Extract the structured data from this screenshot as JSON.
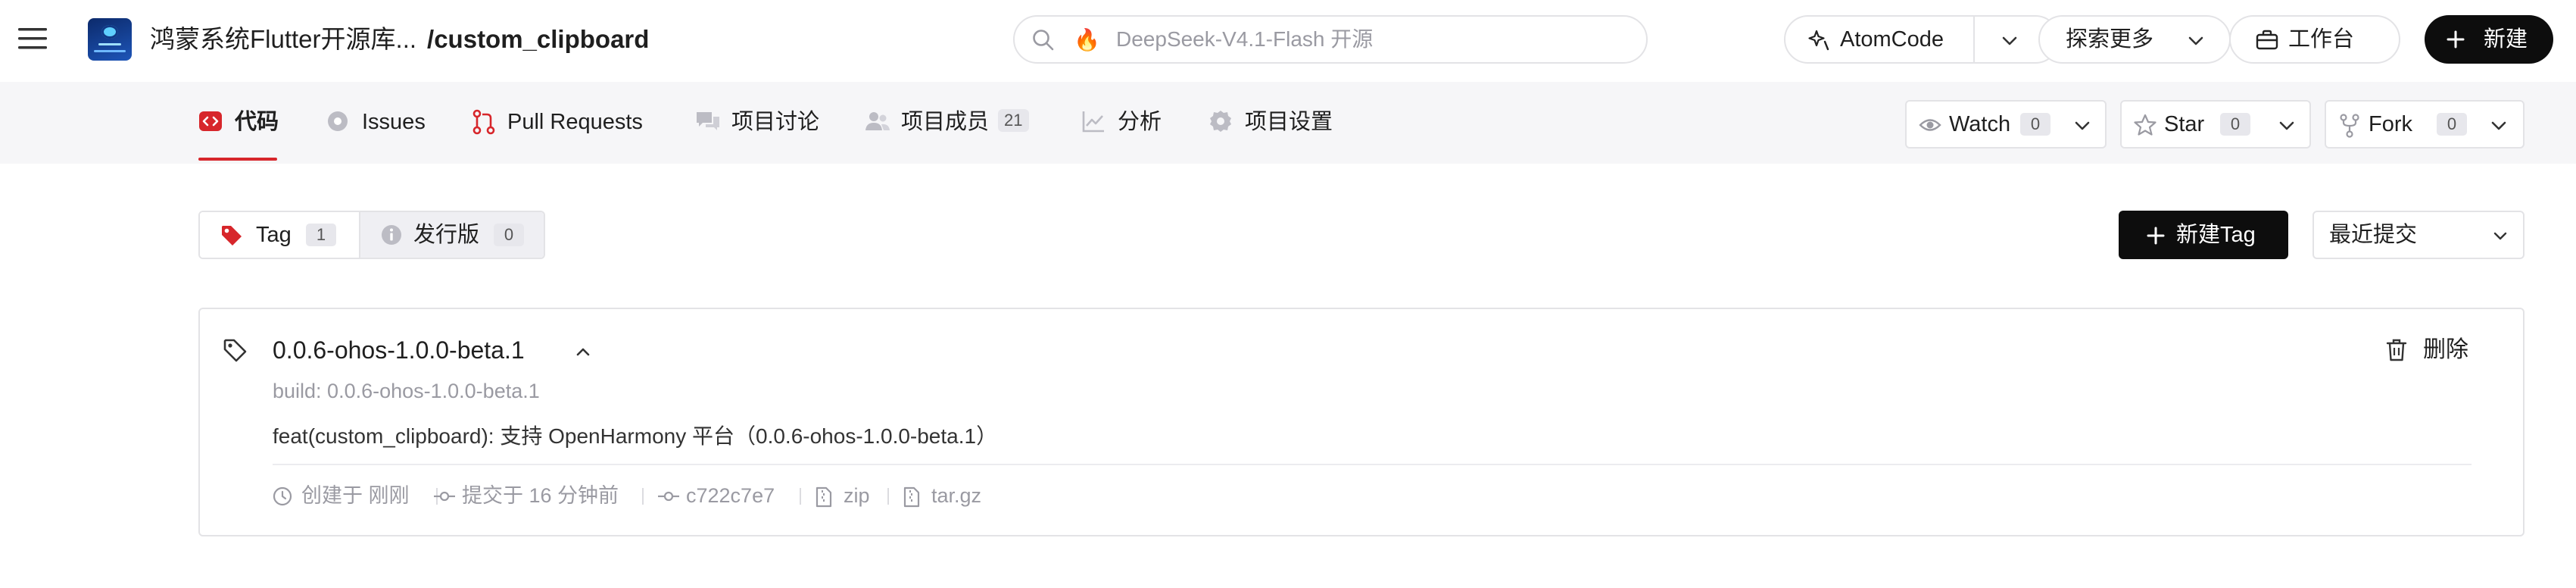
{
  "header": {
    "org_name": "鸿蒙系统Flutter开源库...",
    "repo_name": "/custom_clipboard",
    "search_placeholder": "DeepSeek-V4.1-Flash 开源",
    "atomcode_label": "AtomCode",
    "explore_label": "探索更多",
    "workbench_label": "工作台",
    "new_label": "新建"
  },
  "nav": {
    "tabs": [
      {
        "label": "代码",
        "icon": "code-icon",
        "active": true
      },
      {
        "label": "Issues",
        "icon": "issues-icon"
      },
      {
        "label": "Pull Requests",
        "icon": "pull-request-icon"
      },
      {
        "label": "项目讨论",
        "icon": "discussion-icon"
      },
      {
        "label": "项目成员",
        "icon": "members-icon",
        "count": "21"
      },
      {
        "label": "分析",
        "icon": "analytics-icon"
      },
      {
        "label": "项目设置",
        "icon": "settings-icon"
      }
    ],
    "watch": {
      "label": "Watch",
      "count": "0"
    },
    "star": {
      "label": "Star",
      "count": "0"
    },
    "fork": {
      "label": "Fork",
      "count": "0"
    }
  },
  "releases": {
    "tag_tab": {
      "label": "Tag",
      "count": "1"
    },
    "release_tab": {
      "label": "发行版",
      "count": "0"
    },
    "new_tag_label": "新建Tag",
    "sort_label": "最近提交"
  },
  "tag_card": {
    "name": "0.0.6-ohos-1.0.0-beta.1",
    "build": "build: 0.0.6-ohos-1.0.0-beta.1",
    "message": "feat(custom_clipboard): 支持 OpenHarmony 平台（0.0.6-ohos-1.0.0-beta.1）",
    "created": "创建于 刚刚",
    "committed": "提交于 16 分钟前",
    "commit_hash": "c722c7e7",
    "zip_label": "zip",
    "targz_label": "tar.gz",
    "delete_label": "删除"
  },
  "colors": {
    "accent_red": "#d7262b",
    "dark_button": "#0d0d0d",
    "muted_text": "#9a9aa2"
  }
}
